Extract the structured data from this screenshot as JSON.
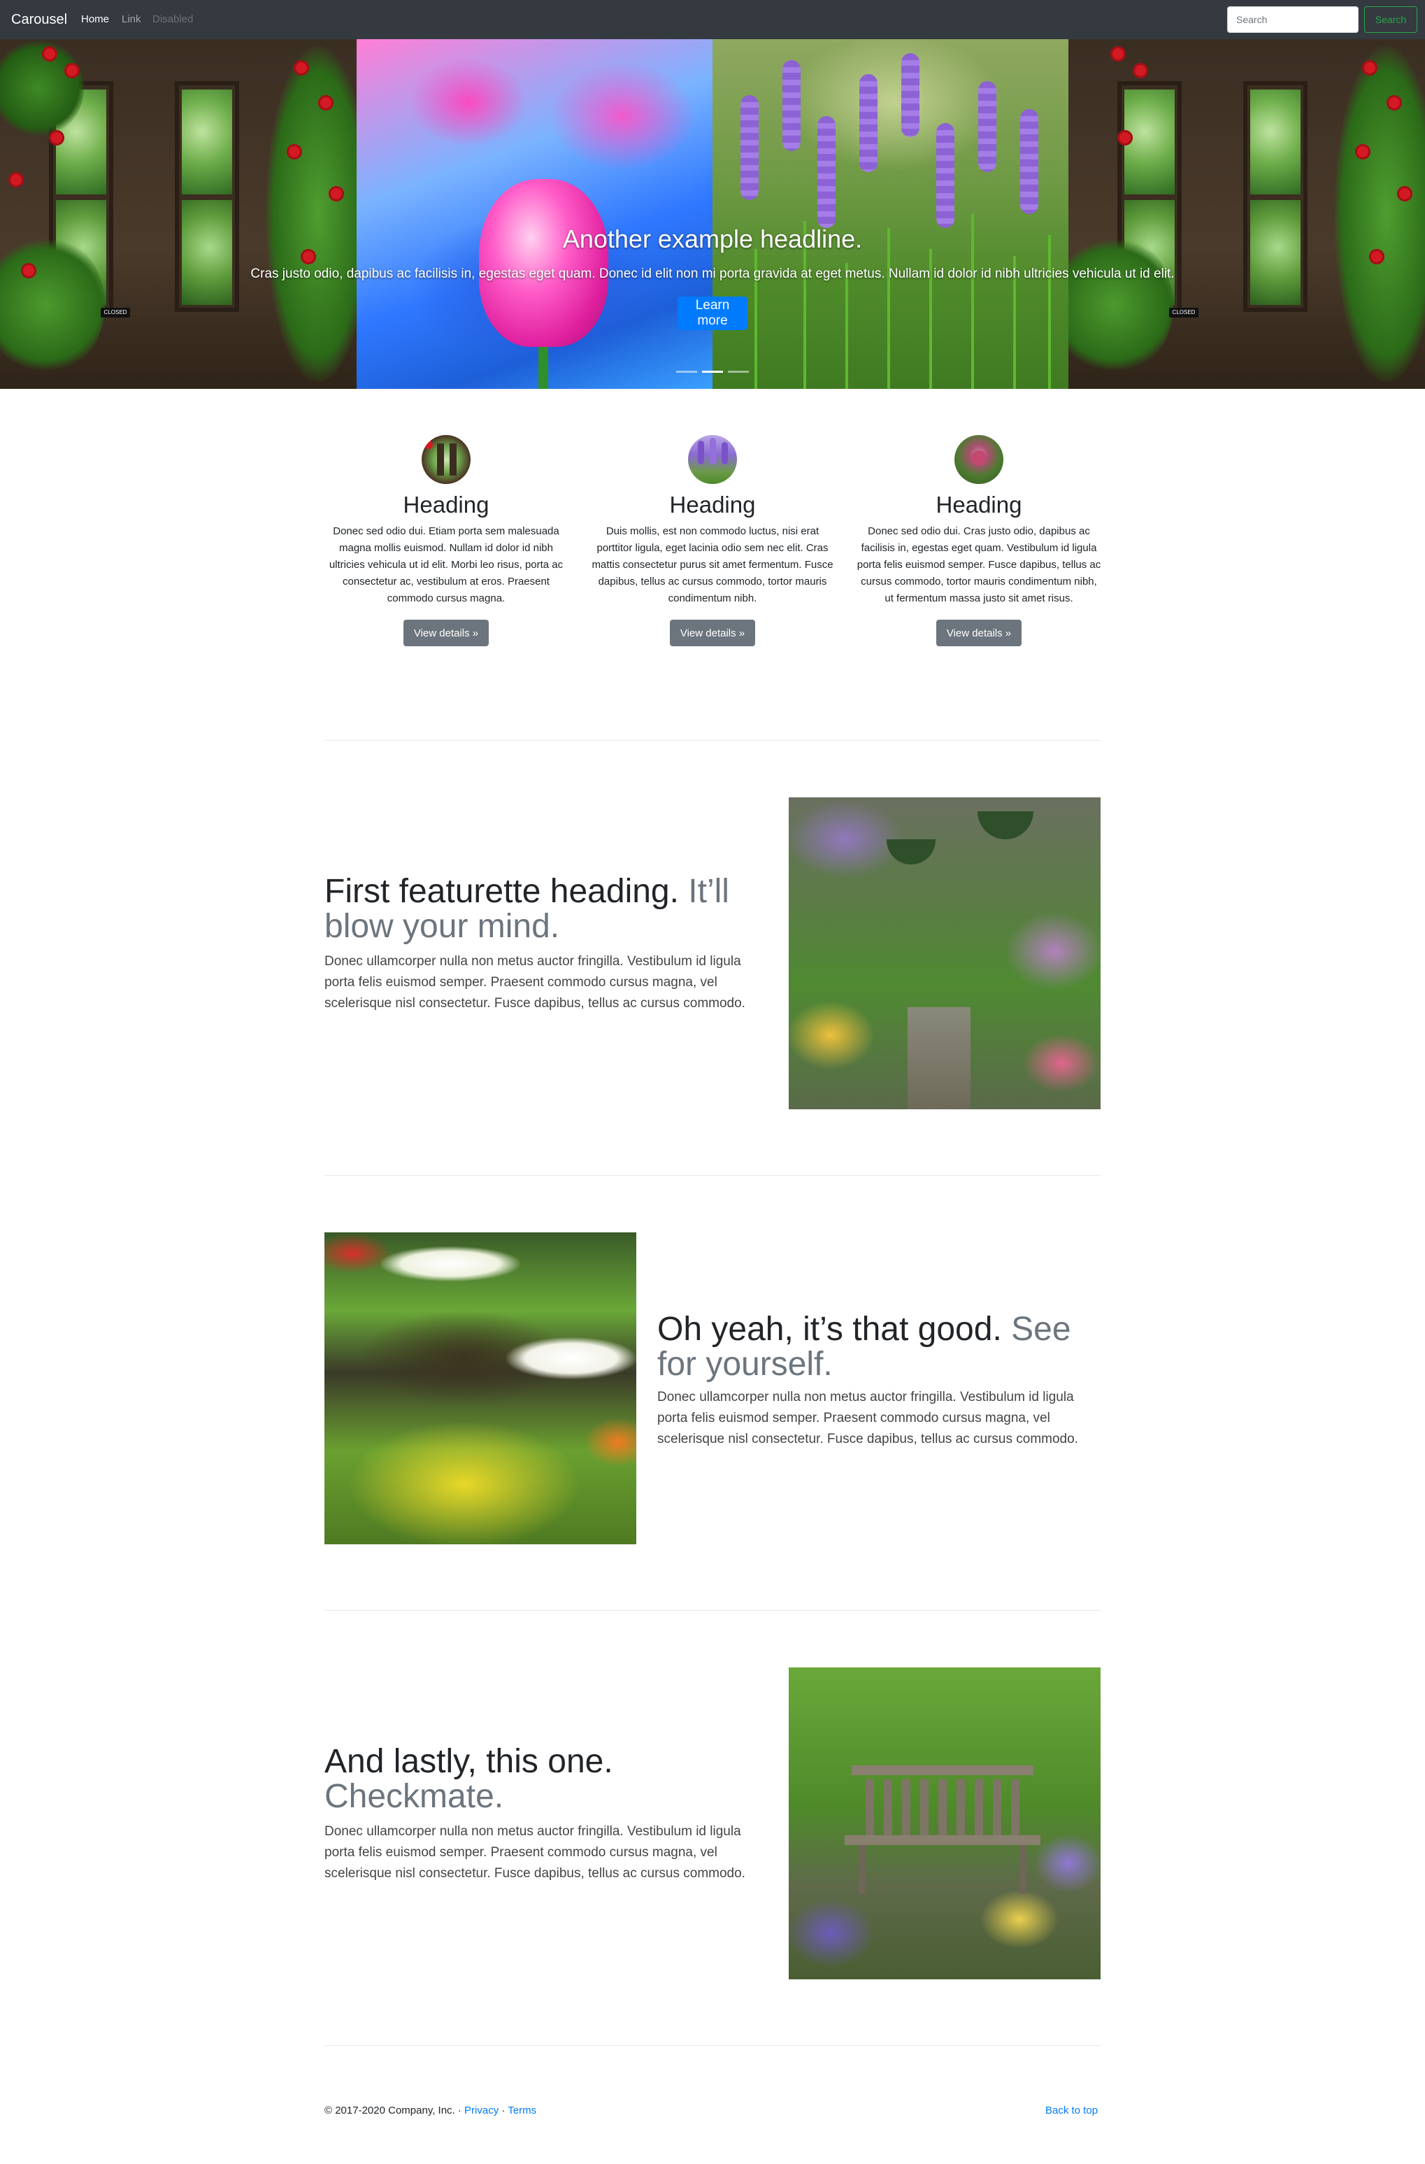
{
  "navbar": {
    "brand": "Carousel",
    "links": [
      "Home",
      "Link",
      "Disabled"
    ],
    "search_placeholder": "Search",
    "search_button": "Search"
  },
  "carousel": {
    "title": "Another example headline.",
    "text": "Cras justo odio, dapibus ac facilisis in, egestas eget quam. Donec id elit non mi porta gravida at eget metus. Nullam id dolor id nibh ultricies vehicula ut id elit.",
    "button": "Learn more",
    "sign_text": "CLOSED",
    "indicator_count": 3,
    "active_indicator": 2
  },
  "columns": [
    {
      "heading": "Heading",
      "text": "Donec sed odio dui. Etiam porta sem malesuada magna mollis euismod. Nullam id dolor id nibh ultricies vehicula ut id elit. Morbi leo risus, porta ac consectetur ac, vestibulum at eros. Praesent commodo cursus magna.",
      "button": "View details »"
    },
    {
      "heading": "Heading",
      "text": "Duis mollis, est non commodo luctus, nisi erat porttitor ligula, eget lacinia odio sem nec elit. Cras mattis consectetur purus sit amet fermentum. Fusce dapibus, tellus ac cursus commodo, tortor mauris condimentum nibh.",
      "button": "View details »"
    },
    {
      "heading": "Heading",
      "text": "Donec sed odio dui. Cras justo odio, dapibus ac facilisis in, egestas eget quam. Vestibulum id ligula porta felis euismod semper. Fusce dapibus, tellus ac cursus commodo, tortor mauris condimentum nibh, ut fermentum massa justo sit amet risus.",
      "button": "View details »"
    }
  ],
  "featurettes": [
    {
      "heading": "First featurette heading.",
      "muted": "It’ll blow your mind.",
      "text": "Donec ullamcorper nulla non metus auctor fringilla. Vestibulum id ligula porta felis euismod semper. Praesent commodo cursus magna, vel scelerisque nisl consectetur. Fusce dapibus, tellus ac cursus commodo."
    },
    {
      "heading": "Oh yeah, it’s that good.",
      "muted": "See for yourself.",
      "text": "Donec ullamcorper nulla non metus auctor fringilla. Vestibulum id ligula porta felis euismod semper. Praesent commodo cursus magna, vel scelerisque nisl consectetur. Fusce dapibus, tellus ac cursus commodo."
    },
    {
      "heading": "And lastly, this one.",
      "muted": "Checkmate.",
      "text": "Donec ullamcorper nulla non metus auctor fringilla. Vestibulum id ligula porta felis euismod semper. Praesent commodo cursus magna, vel scelerisque nisl consectetur. Fusce dapibus, tellus ac cursus commodo."
    }
  ],
  "footer": {
    "copyright": "© 2017-2020 Company, Inc. · ",
    "privacy": "Privacy",
    "sep": " · ",
    "terms": "Terms",
    "back_to_top": "Back to top"
  },
  "colors": {
    "navbar_bg": "#343a40",
    "primary": "#007bff",
    "secondary": "#6c757d",
    "success": "#28a745"
  }
}
